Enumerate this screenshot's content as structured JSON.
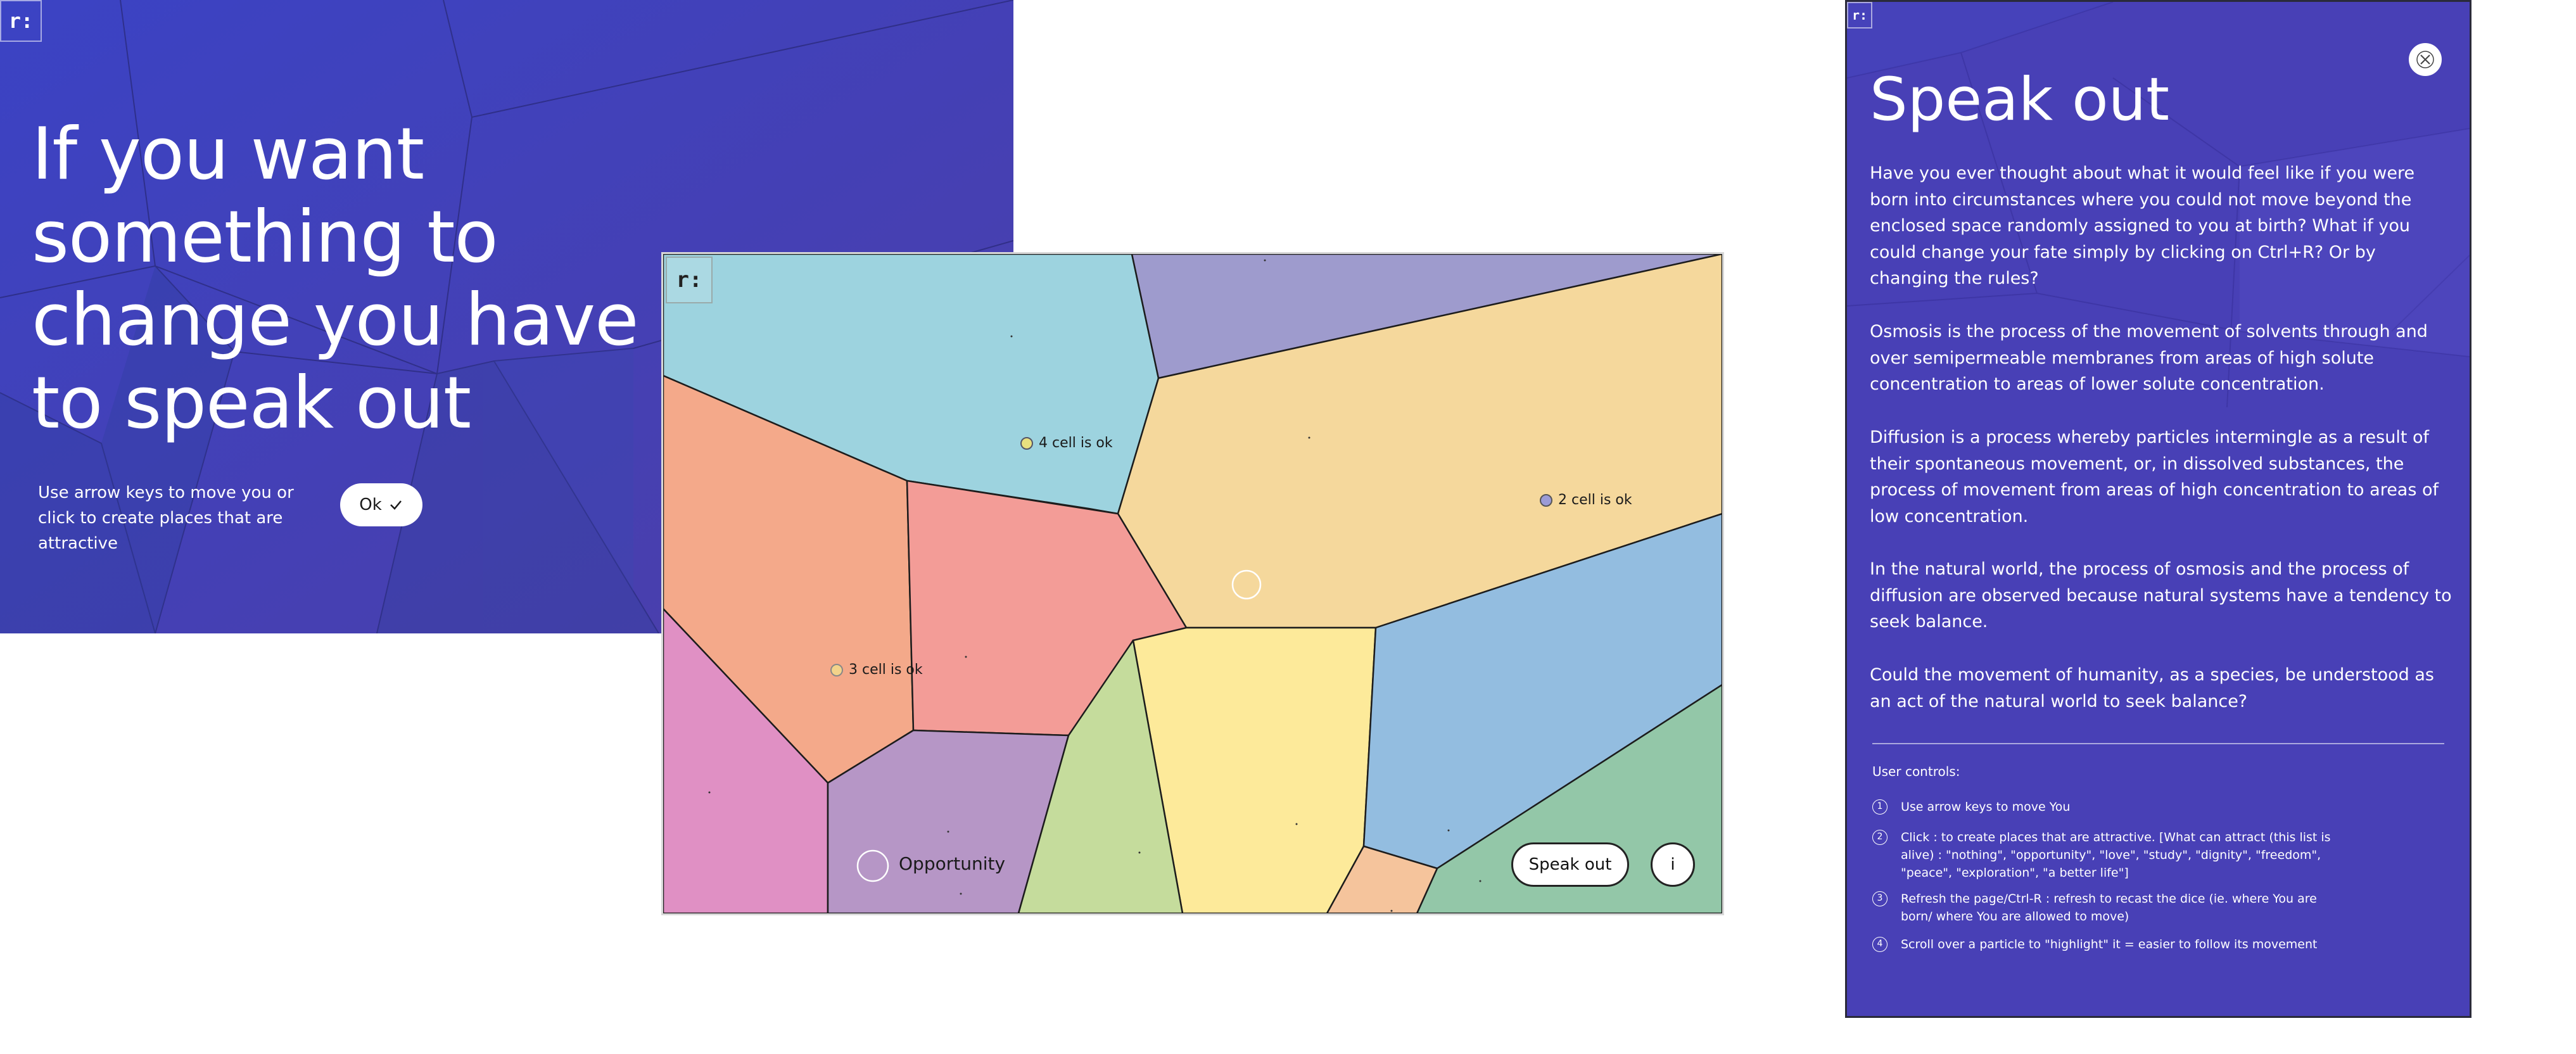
{
  "intro": {
    "logo": "r:",
    "heading": "If you want something to change you have to speak out",
    "instruction": "Use arrow keys to move you or click to create places that are attractive",
    "ok_label": "Ok",
    "ok_icon": "check-icon"
  },
  "map": {
    "logo": "r:",
    "markers": [
      {
        "label": "4 cell is ok",
        "color": "#e9e07f"
      },
      {
        "label": "2 cell is ok",
        "color": "#9b9bd6"
      },
      {
        "label": "3 cell is ok",
        "color": "#f3d38a"
      }
    ],
    "opportunity_label": "Opportunity",
    "speak_out_label": "Speak out",
    "info_label": "i",
    "cell_colors": [
      "#9dd3df",
      "#9e9bcd",
      "#f5d89c",
      "#f4a98a",
      "#f39c97",
      "#fdea9a",
      "#93bde0",
      "#e090c4",
      "#b696c6",
      "#c5dc9c",
      "#93c7a8",
      "#f5c49c"
    ]
  },
  "info": {
    "logo": "r:",
    "close_icon": "close-icon",
    "title": "Speak out",
    "para1": "Have you ever thought about what it would feel like if you were born into circumstances where you could not move beyond the enclosed space randomly assigned to you at birth? What if you could change your fate simply by clicking on Ctrl+R? Or by changing the rules?",
    "para2": "Osmosis is the process of the movement of solvents through and over semipermeable membranes from areas of high solute concentration to areas of lower solute concentration.",
    "para3": "Diffusion is a process whereby particles intermingle as a result of their spontaneous movement, or, in dissolved substances, the process of movement from areas of high concentration to areas of low concentration.",
    "para4": "In the natural world, the process of osmosis and the process of diffusion are observed because natural systems have a tendency to seek balance.",
    "para5": "Could the movement of humanity, as a species, be understood as an act of the natural world to seek balance?",
    "controls_heading": "User controls:",
    "controls": [
      {
        "num": "1",
        "text": "Use arrow keys to move You"
      },
      {
        "num": "2",
        "text": "Click : to create places that are attractive. [What can attract (this list is alive) : \"nothing\", \"opportunity\", \"love\", \"study\", \"dignity\", \"freedom\", \"peace\", \"exploration\", \"a better life\"]"
      },
      {
        "num": "3",
        "text": "Refresh the page/Ctrl-R : refresh to recast the dice (ie. where You are born/ where You are allowed to move)"
      },
      {
        "num": "4",
        "text": "Scroll over a particle to \"highlight\" it = easier to follow its movement"
      }
    ]
  }
}
